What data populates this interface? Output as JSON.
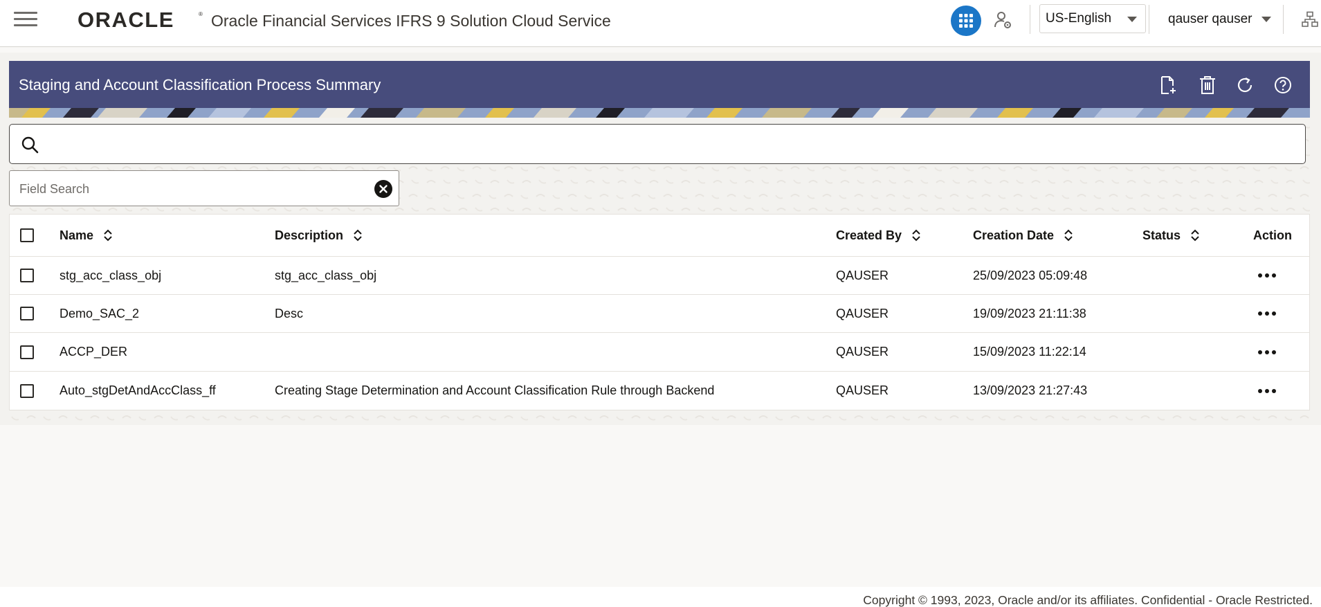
{
  "header": {
    "logo_text": "ORACLE",
    "app_title": "Oracle Financial Services IFRS 9 Solution Cloud Service",
    "language": "US-English",
    "user_name": "qauser qauser"
  },
  "page": {
    "title": "Staging and Account Classification Process Summary",
    "search_value": "",
    "field_search_placeholder": "Field Search"
  },
  "table": {
    "columns": {
      "name": "Name",
      "description": "Description",
      "created_by": "Created By",
      "creation_date": "Creation Date",
      "status": "Status",
      "action": "Action"
    },
    "rows": [
      {
        "name": "stg_acc_class_obj",
        "description": "stg_acc_class_obj",
        "created_by": "QAUSER",
        "creation_date": "25/09/2023 05:09:48",
        "status": ""
      },
      {
        "name": "Demo_SAC_2",
        "description": "Desc",
        "created_by": "QAUSER",
        "creation_date": "19/09/2023 21:11:38",
        "status": ""
      },
      {
        "name": "ACCP_DER",
        "description": "",
        "created_by": "QAUSER",
        "creation_date": "15/09/2023 11:22:14",
        "status": ""
      },
      {
        "name": "Auto_stgDetAndAccClass_ff",
        "description": "Creating Stage Determination and Account Classification Rule through Backend",
        "created_by": "QAUSER",
        "creation_date": "13/09/2023 21:27:43",
        "status": ""
      }
    ]
  },
  "footer": {
    "copyright": "Copyright © 1993, 2023, Oracle and/or its affiliates.  Confidential - Oracle Restricted."
  },
  "colors": {
    "title_bar": "#474c7c",
    "apps_button": "#1b76c7",
    "oracle_red": "#c74634"
  },
  "icons": {
    "menu": "hamburger-icon",
    "apps": "grid-icon",
    "user_admin": "user-gear-icon",
    "hierarchy": "hierarchy-icon",
    "add": "new-document-icon",
    "delete": "trash-icon",
    "refresh": "refresh-icon",
    "help": "help-icon",
    "search": "search-icon",
    "clear": "clear-icon",
    "sort": "sort-icon",
    "more": "more-options-icon"
  }
}
